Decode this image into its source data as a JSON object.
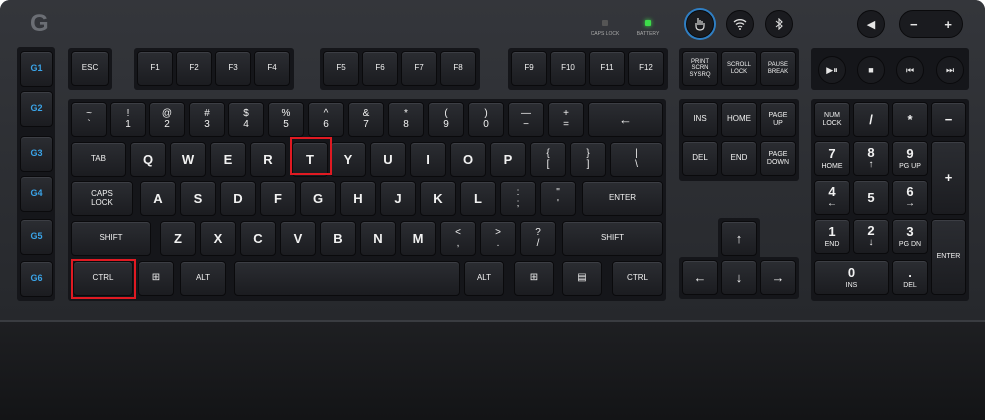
{
  "brand": {
    "logo": "G"
  },
  "indicators": {
    "caps_lock": "CAPS LOCK",
    "battery": "BATTERY"
  },
  "media_top": {
    "mute": "◀",
    "vol_minus": "−",
    "vol_plus": "+"
  },
  "gkeys": [
    "G1",
    "G2",
    "G3",
    "G4",
    "G5",
    "G6"
  ],
  "fn_row": {
    "esc": "ESC",
    "f": [
      "F1",
      "F2",
      "F3",
      "F4",
      "F5",
      "F6",
      "F7",
      "F8",
      "F9",
      "F10",
      "F11",
      "F12"
    ],
    "print": "PRINT\nSCRN\nSYSRQ",
    "scroll": "SCROLL\nLOCK",
    "pause": "PAUSE\nBREAK"
  },
  "media": [
    "▶⏸",
    "■",
    "⏮",
    "⏭"
  ],
  "number_row": [
    {
      "top": "~",
      "bot": "`"
    },
    {
      "top": "!",
      "bot": "1"
    },
    {
      "top": "@",
      "bot": "2"
    },
    {
      "top": "#",
      "bot": "3"
    },
    {
      "top": "$",
      "bot": "4"
    },
    {
      "top": "%",
      "bot": "5"
    },
    {
      "top": "^",
      "bot": "6"
    },
    {
      "top": "&",
      "bot": "7"
    },
    {
      "top": "*",
      "bot": "8"
    },
    {
      "top": "(",
      "bot": "9"
    },
    {
      "top": ")",
      "bot": "0"
    },
    {
      "top": "—",
      "bot": "−"
    },
    {
      "top": "+",
      "bot": "="
    }
  ],
  "backspace": "←",
  "tab": "TAB",
  "qwerty": [
    "Q",
    "W",
    "E",
    "R",
    "T",
    "Y",
    "U",
    "I",
    "O",
    "P"
  ],
  "brackets": [
    {
      "top": "{",
      "bot": "["
    },
    {
      "top": "}",
      "bot": "]"
    },
    {
      "top": "|",
      "bot": "\\"
    }
  ],
  "caps": "CAPS\nLOCK",
  "asdf": [
    "A",
    "S",
    "D",
    "F",
    "G",
    "H",
    "J",
    "K",
    "L"
  ],
  "semi": [
    {
      "top": ":",
      "bot": ";"
    },
    {
      "top": "\"",
      "bot": "'"
    }
  ],
  "enter": "ENTER",
  "shift": "SHIFT",
  "zxcv": [
    "Z",
    "X",
    "C",
    "V",
    "B",
    "N",
    "M"
  ],
  "punct": [
    {
      "top": "<",
      "bot": ","
    },
    {
      "top": ">",
      "bot": "."
    },
    {
      "top": "?",
      "bot": "/"
    }
  ],
  "bottom": {
    "ctrl": "CTRL",
    "alt": "ALT",
    "win": "⊞",
    "menu": "▤"
  },
  "nav": {
    "ins": "INS",
    "home": "HOME",
    "pgup": "PAGE\nUP",
    "del": "DEL",
    "end": "END",
    "pgdn": "PAGE\nDOWN"
  },
  "arrows": {
    "up": "↑",
    "left": "←",
    "down": "↓",
    "right": "→"
  },
  "numpad": {
    "numlock": "NUM\nLOCK",
    "div": "/",
    "mul": "*",
    "minus": "−",
    "plus": "+",
    "enter": "ENTER",
    "n7": {
      "m": "7",
      "s": "HOME"
    },
    "n8": {
      "m": "8",
      "s": "↑"
    },
    "n9": {
      "m": "9",
      "s": "PG UP"
    },
    "n4": {
      "m": "4",
      "s": "←"
    },
    "n5": {
      "m": "5",
      "s": ""
    },
    "n6": {
      "m": "6",
      "s": "→"
    },
    "n1": {
      "m": "1",
      "s": "END"
    },
    "n2": {
      "m": "2",
      "s": "↓"
    },
    "n3": {
      "m": "3",
      "s": "PG DN"
    },
    "n0": {
      "m": "0",
      "s": "INS"
    },
    "ndot": {
      "m": ".",
      "s": "DEL"
    }
  },
  "colors": {
    "highlight": "#e01a22",
    "gkey": "#3aa4e8",
    "battery_led": "#3ddc4a"
  }
}
